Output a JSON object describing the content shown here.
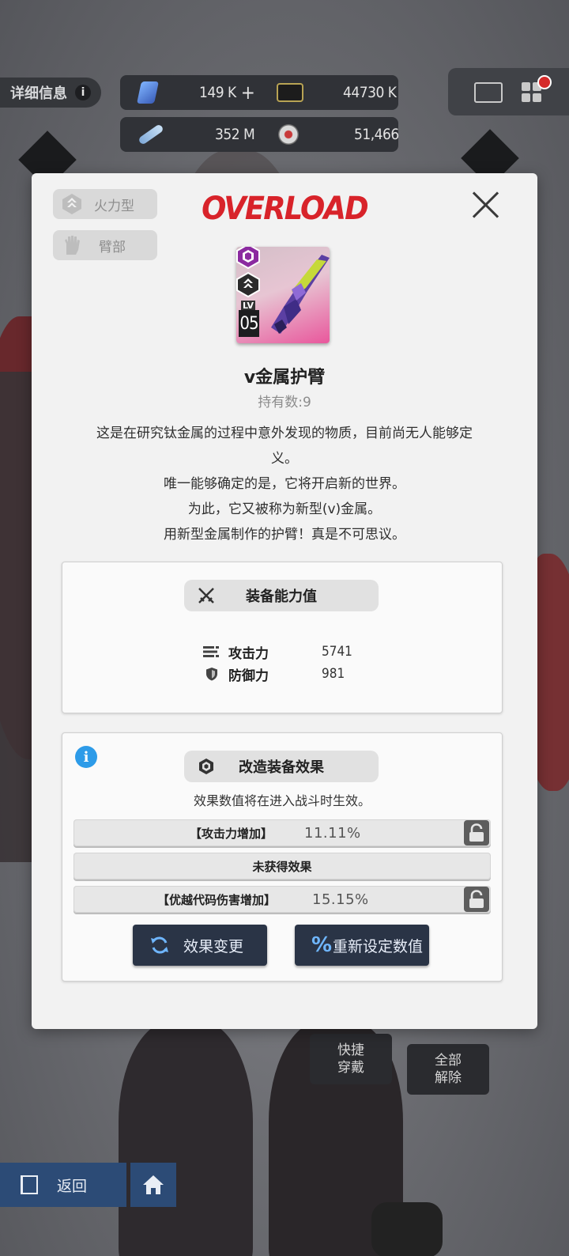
{
  "hud": {
    "detail_label": "详细信息",
    "info_glyph": "i",
    "resources": [
      {
        "icon": "crystal-icon",
        "value": "149 K",
        "plus": "+"
      },
      {
        "icon": "battery-icon",
        "value": "44730 K"
      },
      {
        "icon": "module-icon",
        "value": "352 M"
      },
      {
        "icon": "core-orb-icon",
        "value": "51,466"
      }
    ]
  },
  "bottom": {
    "quick_equip": [
      "快捷",
      "穿戴"
    ],
    "unequip_all": [
      "全部",
      "解除"
    ],
    "back_label": "返回"
  },
  "modal": {
    "tags": [
      "火力型",
      "臂部"
    ],
    "brand": "OVERLOAD",
    "item": {
      "lv_label": "LV",
      "level": "05",
      "name": "v金属护臂",
      "holding": "持有数:9"
    },
    "description": [
      "这是在研究钛金属的过程中意外发现的物质，目前尚无人能够定",
      "义。",
      "唯一能够确定的是，它将开启新的世界。",
      "为此，它又被称为新型(v)金属。",
      "用新型金属制作的护臂！真是不可思议。"
    ],
    "stats_title": "装备能力值",
    "stats": [
      {
        "label": "攻击力",
        "value": "5741"
      },
      {
        "label": "防御力",
        "value": "981"
      }
    ],
    "effects_title": "改造装备效果",
    "effects_note": "效果数值将在进入战斗时生效。",
    "effects": [
      {
        "name": "【攻击力增加】",
        "value": "11.11%",
        "locked": true
      },
      {
        "name": "未获得效果",
        "value": "",
        "locked": false
      },
      {
        "name": "【优越代码伤害增加】",
        "value": "15.15%",
        "locked": true
      }
    ],
    "buttons": {
      "change": "效果变更",
      "reset": "重新设定数值",
      "reset_glyph": "%"
    }
  },
  "colors": {
    "brand_red": "#d8232a",
    "info_blue": "#2d9be8",
    "button_dark": "#2a3446",
    "button_accent": "#6fb6ff"
  }
}
